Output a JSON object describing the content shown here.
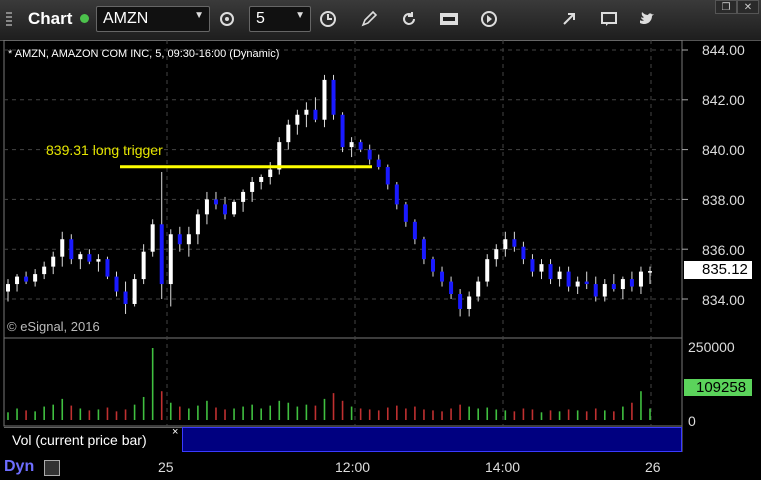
{
  "toolbar": {
    "title": "Chart",
    "symbol": "AMZN",
    "interval": "5",
    "window_controls": [
      "restore",
      "close"
    ]
  },
  "chart": {
    "description": "* AMZN, AMAZON COM INC, 5, 09:30-16:00 (Dynamic)",
    "annotation": "839.31 long trigger",
    "copyright": "© eSignal, 2016",
    "current_price": "835.12",
    "current_volume": "109258",
    "volume_study": "Vol (current price bar)",
    "legend_close": "×",
    "dyn_label": "Dyn",
    "colors": {
      "up": "#ffffff",
      "down": "#1a1aff",
      "trigger": "#ffff00",
      "vol_up": "#40c040",
      "vol_down": "#c03030"
    }
  },
  "chart_data": {
    "type": "candlestick",
    "price_axis_ticks": [
      "844.00",
      "842.00",
      "840.00",
      "838.00",
      "836.00",
      "834.00"
    ],
    "volume_axis_ticks": [
      "250000",
      "0"
    ],
    "time_axis_ticks": [
      "25",
      "12:00",
      "14:00",
      "26"
    ],
    "ylim": [
      833.0,
      844.4
    ],
    "trigger_level": 839.31,
    "candles": [
      [
        834.3,
        834.8,
        833.9,
        834.6
      ],
      [
        834.6,
        835.0,
        834.3,
        834.9
      ],
      [
        834.9,
        835.1,
        834.6,
        834.7
      ],
      [
        834.7,
        835.2,
        834.5,
        835.0
      ],
      [
        835.0,
        835.5,
        834.8,
        835.3
      ],
      [
        835.3,
        835.9,
        835.0,
        835.7
      ],
      [
        835.7,
        836.7,
        835.3,
        836.4
      ],
      [
        836.4,
        836.6,
        835.4,
        835.6
      ],
      [
        835.6,
        835.9,
        835.2,
        835.8
      ],
      [
        835.8,
        836.0,
        835.4,
        835.5
      ],
      [
        835.5,
        835.8,
        835.1,
        835.6
      ],
      [
        835.6,
        835.7,
        834.8,
        834.9
      ],
      [
        834.9,
        835.1,
        834.1,
        834.3
      ],
      [
        834.3,
        834.7,
        833.4,
        833.8
      ],
      [
        833.8,
        835.0,
        833.7,
        834.8
      ],
      [
        834.8,
        836.2,
        834.6,
        835.9
      ],
      [
        835.9,
        837.2,
        835.7,
        837.0
      ],
      [
        837.0,
        839.1,
        834.0,
        834.6
      ],
      [
        834.6,
        836.8,
        833.7,
        836.6
      ],
      [
        836.6,
        836.9,
        835.9,
        836.2
      ],
      [
        836.2,
        836.9,
        835.7,
        836.6
      ],
      [
        836.6,
        837.6,
        836.2,
        837.4
      ],
      [
        837.4,
        838.3,
        837.0,
        838.0
      ],
      [
        838.0,
        838.3,
        837.6,
        837.8
      ],
      [
        837.8,
        838.1,
        837.2,
        837.4
      ],
      [
        837.4,
        838.0,
        837.3,
        837.9
      ],
      [
        837.9,
        838.4,
        837.5,
        838.3
      ],
      [
        838.3,
        838.9,
        837.9,
        838.7
      ],
      [
        838.7,
        839.0,
        838.4,
        838.9
      ],
      [
        838.9,
        839.5,
        838.6,
        839.2
      ],
      [
        839.2,
        840.5,
        839.0,
        840.3
      ],
      [
        840.3,
        841.2,
        840.0,
        841.0
      ],
      [
        841.0,
        841.6,
        840.6,
        841.4
      ],
      [
        841.4,
        841.9,
        840.9,
        841.6
      ],
      [
        841.6,
        842.1,
        841.1,
        841.2
      ],
      [
        841.2,
        843.0,
        840.9,
        842.8
      ],
      [
        842.8,
        843.0,
        841.2,
        841.4
      ],
      [
        841.4,
        841.5,
        839.9,
        840.1
      ],
      [
        840.1,
        840.5,
        839.7,
        840.3
      ],
      [
        840.3,
        840.4,
        839.9,
        840.0
      ],
      [
        840.0,
        840.2,
        839.4,
        839.6
      ],
      [
        839.6,
        839.8,
        839.2,
        839.3
      ],
      [
        839.3,
        839.4,
        838.4,
        838.6
      ],
      [
        838.6,
        838.7,
        837.6,
        837.8
      ],
      [
        837.8,
        837.9,
        836.9,
        837.1
      ],
      [
        837.1,
        837.2,
        836.2,
        836.4
      ],
      [
        836.4,
        836.5,
        835.4,
        835.6
      ],
      [
        835.6,
        835.7,
        834.9,
        835.1
      ],
      [
        835.1,
        835.3,
        834.5,
        834.7
      ],
      [
        834.7,
        834.9,
        834.0,
        834.2
      ],
      [
        834.2,
        834.4,
        833.3,
        833.6
      ],
      [
        833.6,
        834.3,
        833.3,
        834.1
      ],
      [
        834.1,
        834.9,
        833.9,
        834.7
      ],
      [
        834.7,
        835.8,
        834.5,
        835.6
      ],
      [
        835.6,
        836.2,
        835.3,
        836.0
      ],
      [
        836.0,
        836.7,
        835.7,
        836.4
      ],
      [
        836.4,
        836.7,
        835.9,
        836.1
      ],
      [
        836.1,
        836.3,
        835.4,
        835.6
      ],
      [
        835.6,
        835.8,
        834.9,
        835.1
      ],
      [
        835.1,
        835.6,
        834.8,
        835.4
      ],
      [
        835.4,
        835.6,
        834.6,
        834.8
      ],
      [
        834.8,
        835.3,
        834.5,
        835.1
      ],
      [
        835.1,
        835.3,
        834.3,
        834.5
      ],
      [
        834.5,
        834.9,
        834.2,
        834.7
      ],
      [
        834.7,
        835.1,
        834.4,
        834.6
      ],
      [
        834.6,
        834.9,
        833.9,
        834.1
      ],
      [
        834.1,
        834.8,
        833.9,
        834.6
      ],
      [
        834.6,
        835.0,
        834.3,
        834.4
      ],
      [
        834.4,
        834.9,
        834.0,
        834.8
      ],
      [
        834.8,
        835.1,
        834.3,
        834.5
      ],
      [
        834.5,
        835.3,
        834.2,
        835.1
      ],
      [
        835.1,
        835.3,
        834.6,
        835.12
      ]
    ],
    "volume": [
      8,
      12,
      10,
      9,
      14,
      16,
      22,
      15,
      12,
      10,
      11,
      13,
      9,
      11,
      16,
      24,
      75,
      30,
      18,
      14,
      12,
      15,
      20,
      13,
      11,
      12,
      14,
      16,
      12,
      15,
      20,
      18,
      14,
      16,
      15,
      22,
      28,
      20,
      14,
      12,
      11,
      10,
      13,
      15,
      12,
      14,
      11,
      10,
      9,
      12,
      16,
      14,
      12,
      13,
      11,
      10,
      9,
      12,
      11,
      8,
      10,
      9,
      11,
      10,
      9,
      12,
      10,
      9,
      14,
      18,
      30,
      12
    ]
  }
}
